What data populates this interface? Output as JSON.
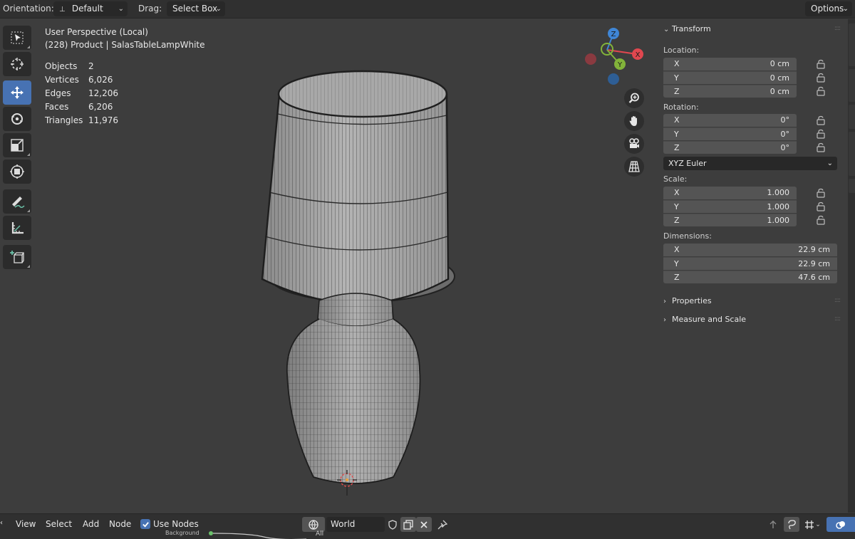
{
  "header": {
    "orientation_label": "Orientation:",
    "orientation_value": "Default",
    "drag_label": "Drag:",
    "drag_value": "Select Box",
    "options_label": "Options"
  },
  "toolbar": {
    "tools": [
      "select-box-icon",
      "cursor-icon",
      "move-icon",
      "rotate-icon",
      "scale-icon",
      "transform-icon",
      "annotate-icon",
      "measure-icon",
      "add-cube-icon"
    ],
    "active_tool": "move-icon"
  },
  "viewport": {
    "title": "User Perspective (Local)",
    "subtitle": "(228) Product | SalasTableLampWhite",
    "stats": [
      {
        "label": "Objects",
        "value": "2"
      },
      {
        "label": "Vertices",
        "value": "6,026"
      },
      {
        "label": "Edges",
        "value": "12,206"
      },
      {
        "label": "Faces",
        "value": "6,206"
      },
      {
        "label": "Triangles",
        "value": "11,976"
      }
    ],
    "gizmo": {
      "x": "X",
      "y": "Y",
      "z": "Z",
      "colors": {
        "x": "#e0474f",
        "y": "#82b33a",
        "z": "#3f86d6"
      }
    },
    "nav_buttons": [
      "zoom-icon",
      "hand-pan-icon",
      "camera-icon",
      "grid-perspective-icon"
    ]
  },
  "npanel": {
    "transform_header": "Transform",
    "location_label": "Location:",
    "location": [
      {
        "axis": "X",
        "value": "0 cm"
      },
      {
        "axis": "Y",
        "value": "0 cm"
      },
      {
        "axis": "Z",
        "value": "0 cm"
      }
    ],
    "rotation_label": "Rotation:",
    "rotation": [
      {
        "axis": "X",
        "value": "0°"
      },
      {
        "axis": "Y",
        "value": "0°"
      },
      {
        "axis": "Z",
        "value": "0°"
      }
    ],
    "rotation_mode": "XYZ Euler",
    "scale_label": "Scale:",
    "scale": [
      {
        "axis": "X",
        "value": "1.000"
      },
      {
        "axis": "Y",
        "value": "1.000"
      },
      {
        "axis": "Z",
        "value": "1.000"
      }
    ],
    "dimensions_label": "Dimensions:",
    "dimensions": [
      {
        "axis": "X",
        "value": "22.9 cm"
      },
      {
        "axis": "Y",
        "value": "22.9 cm"
      },
      {
        "axis": "Z",
        "value": "47.6 cm"
      }
    ],
    "properties_header": "Properties",
    "measure_header": "Measure and Scale"
  },
  "bottom": {
    "menu": [
      "View",
      "Select",
      "Add",
      "Node"
    ],
    "use_nodes_label": "Use Nodes",
    "use_nodes_checked": true,
    "world_value": "World",
    "node_background_label": "Background",
    "node_all_label": "All"
  },
  "colors": {
    "accent": "#4772b3",
    "panel_bg": "#3d3d3d",
    "header_bg": "#303030"
  }
}
